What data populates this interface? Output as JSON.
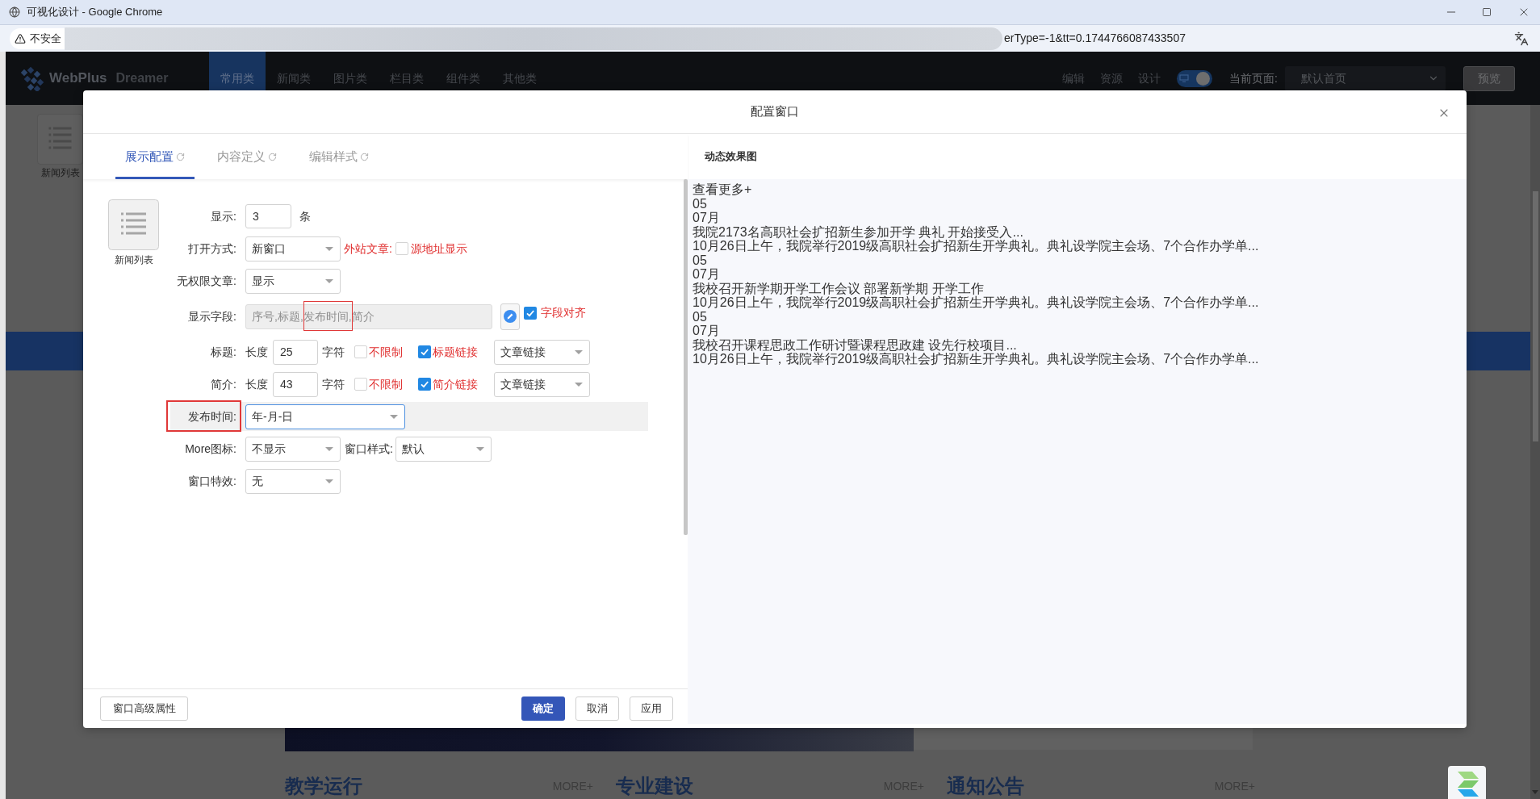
{
  "browser": {
    "title": "可视化设计 - Google Chrome",
    "security_label": "不安全",
    "url": "erType=-1&tt=0.1744766087433507"
  },
  "app_header": {
    "logo": "WebPlus",
    "logo_sub": "Dreamer",
    "tabs": [
      {
        "label": "常用类",
        "selected": true
      },
      {
        "label": "新闻类",
        "selected": false
      },
      {
        "label": "图片类",
        "selected": false
      },
      {
        "label": "栏目类",
        "selected": false
      },
      {
        "label": "组件类",
        "selected": false
      },
      {
        "label": "其他类",
        "selected": false
      }
    ],
    "actions": [
      "编辑",
      "资源",
      "设计"
    ],
    "view_toggle": {
      "on": true
    },
    "page_label": "当前页面:",
    "page_select": "默认首页",
    "preview_button": "预览"
  },
  "toolbox": {
    "items": [
      {
        "label": "新闻列表"
      }
    ]
  },
  "page_sections": [
    {
      "title": "教学运行",
      "more": "MORE+"
    },
    {
      "title": "专业建设",
      "more": "MORE+"
    },
    {
      "title": "通知公告",
      "more": "MORE+"
    }
  ],
  "dialog": {
    "title": "配置窗口",
    "tabs": [
      {
        "label": "展示配置",
        "selected": true
      },
      {
        "label": "内容定义",
        "selected": false
      },
      {
        "label": "编辑样式",
        "selected": false
      }
    ],
    "widget": {
      "label": "新闻列表"
    },
    "rows": [
      {
        "kind": "number",
        "label": "显示:",
        "value": "3",
        "unit": "条",
        "highlighted": false,
        "annotated": false
      },
      {
        "kind": "select",
        "label": "打开方式:",
        "value": "新窗口",
        "note": "外站文章:",
        "option": {
          "label": "源地址显示",
          "checked": false
        },
        "highlighted": false,
        "annotated": false
      },
      {
        "kind": "select",
        "label": "无权限文章:",
        "value": "显示",
        "highlighted": false,
        "annotated": false
      },
      {
        "kind": "fields",
        "label": "显示字段:",
        "value": "序号,标题,发布时间,简介",
        "option": {
          "label": "字段对齐",
          "checked": true
        },
        "highlighted": false,
        "annotated": true
      },
      {
        "kind": "length",
        "label": "标题:",
        "prefix": "长度",
        "value": "25",
        "unit": "字符",
        "unlimited": {
          "label": "不限制",
          "checked": false
        },
        "link": {
          "label": "标题链接",
          "checked": true
        },
        "link_type": "文章链接",
        "highlighted": false,
        "annotated": false
      },
      {
        "kind": "length",
        "label": "简介:",
        "prefix": "长度",
        "value": "43",
        "unit": "字符",
        "unlimited": {
          "label": "不限制",
          "checked": false
        },
        "link": {
          "label": "简介链接",
          "checked": true
        },
        "link_type": "文章链接",
        "highlighted": false,
        "annotated": false
      },
      {
        "kind": "select",
        "label": "发布时间:",
        "value": "年-月-日",
        "highlighted": true,
        "annotated": true
      },
      {
        "kind": "select",
        "label": "More图标:",
        "value": "不显示",
        "extra_label": "窗口样式:",
        "extra_value": "默认",
        "highlighted": false,
        "annotated": false
      },
      {
        "kind": "select",
        "label": "窗口特效:",
        "value": "无",
        "highlighted": false,
        "annotated": false
      }
    ],
    "advanced_button": "窗口高级属性",
    "buttons": [
      {
        "label": "确定",
        "kind": "primary"
      },
      {
        "label": "取消",
        "kind": "default"
      },
      {
        "label": "应用",
        "kind": "default"
      }
    ],
    "preview": {
      "title": "动态效果图",
      "more": "查看更多+",
      "items": [
        {
          "day": "05",
          "month": "07月",
          "title": "我院2173名高职社会扩招新生参加开学 典礼 开始接受入...",
          "summary": "10月26日上午，我院举行2019级高职社会扩招新生开学典礼。典礼设学院主会场、7个合作办学单..."
        },
        {
          "day": "05",
          "month": "07月",
          "title": "我校召开新学期开学工作会议 部署新学期 开学工作",
          "summary": "10月26日上午，我院举行2019级高职社会扩招新生开学典礼。典礼设学院主会场、7个合作办学单..."
        },
        {
          "day": "05",
          "month": "07月",
          "title": "我校召开课程思政工作研讨暨课程思政建 设先行校项目...",
          "summary": "10月26日上午，我院举行2019级高职社会扩招新生开学典礼。典礼设学院主会场、7个合作办学单..."
        }
      ]
    }
  }
}
